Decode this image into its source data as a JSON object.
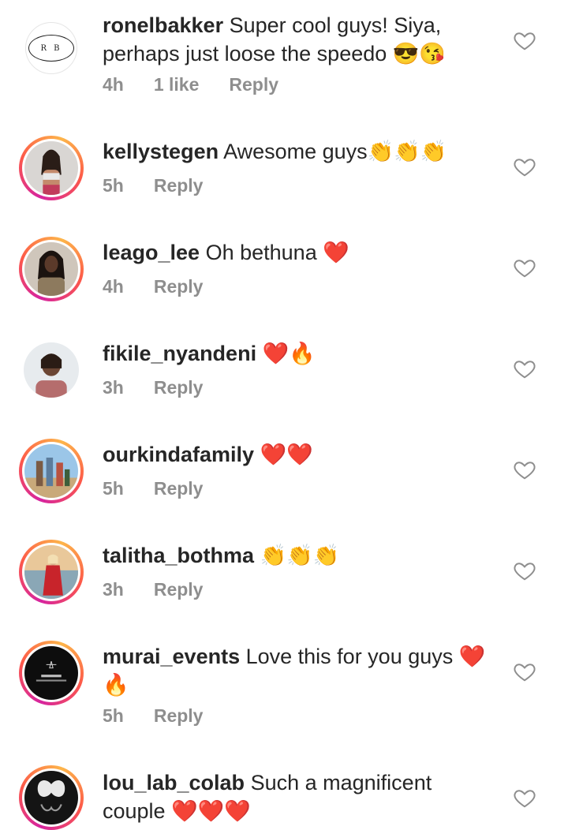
{
  "comments": [
    {
      "username": "ronelbakker",
      "text": "Super cool guys! Siya, perhaps just loose the speedo 😎😘",
      "time": "4h",
      "likes": "1 like",
      "reply": "Reply",
      "avatar_text": "R B"
    },
    {
      "username": "kellystegen",
      "text": "Awesome guys👏👏👏",
      "time": "5h",
      "reply": "Reply"
    },
    {
      "username": "leago_lee",
      "text": "Oh bethuna ❤️",
      "time": "4h",
      "reply": "Reply"
    },
    {
      "username": "fikile_nyandeni",
      "text": "❤️🔥",
      "time": "3h",
      "reply": "Reply"
    },
    {
      "username": "ourkindafamily",
      "text": "❤️❤️",
      "time": "5h",
      "reply": "Reply"
    },
    {
      "username": "talitha_bothma",
      "text": "👏👏👏",
      "time": "3h",
      "reply": "Reply"
    },
    {
      "username": "murai_events",
      "text": "Love this for you guys ❤️ 🔥",
      "time": "5h",
      "reply": "Reply"
    },
    {
      "username": "lou_lab_colab",
      "text": "Such a magnificent couple ❤️❤️❤️"
    }
  ],
  "colors": {
    "username": "#262626",
    "meta": "#8e8e8e",
    "heart_outline": "#8e8e8e"
  },
  "icons": {
    "like": "heart-outline-icon"
  }
}
